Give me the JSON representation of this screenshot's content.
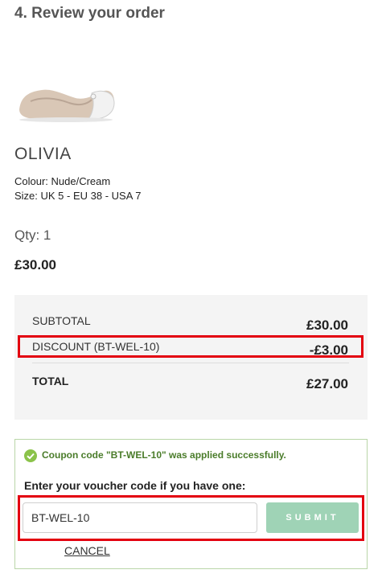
{
  "step": {
    "title": "4. Review your order"
  },
  "product": {
    "image_icon": "shoe-image",
    "name": "OLIVIA",
    "colour_line": "Colour: Nude/Cream",
    "size_line": "Size: UK 5 - EU 38 - USA 7",
    "qty_line": "Qty: 1",
    "price": "£30.00"
  },
  "summary": {
    "subtotal_label": "SUBTOTAL",
    "subtotal_value": "£30.00",
    "discount_label": "DISCOUNT (BT-WEL-10)",
    "discount_value": "-£3.00",
    "total_label": "TOTAL",
    "total_value": "£27.00"
  },
  "voucher": {
    "success_icon": "check-circle-icon",
    "success_message": "Coupon code \"BT-WEL-10\" was applied successfully.",
    "prompt": "Enter your voucher code if you have one:",
    "input_value": "BT-WEL-10",
    "submit_label": "SUBMIT",
    "cancel_label": "CANCEL"
  },
  "colors": {
    "highlight": "#e3000f",
    "submit_bg": "#9fd3b6",
    "success_text": "#4a7c2a",
    "summary_bg": "#f4f4f4"
  }
}
